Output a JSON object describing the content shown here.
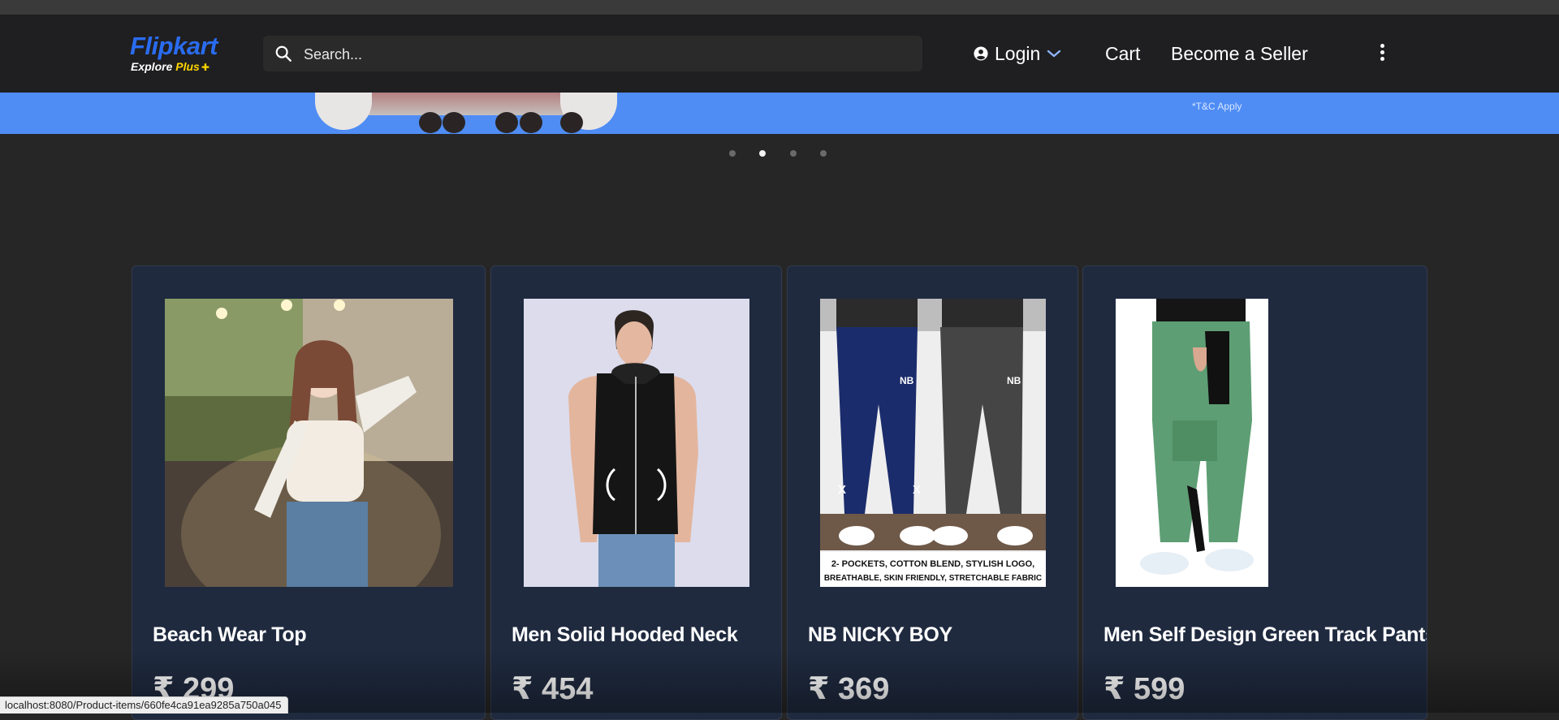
{
  "header": {
    "logo": {
      "name": "Flipkart",
      "sub_prefix": "Explore",
      "sub_plus": "Plus"
    },
    "search": {
      "placeholder": "Search..."
    },
    "login_label": "Login",
    "cart_label": "Cart",
    "seller_label": "Become a Seller"
  },
  "banner": {
    "note": "*T&C Apply"
  },
  "carousel": {
    "dot_count": 4,
    "active_index": 1
  },
  "currency_symbol": "₹",
  "products": [
    {
      "title": "Beach Wear Top",
      "price": "299"
    },
    {
      "title": "Men Solid Hooded Neck",
      "price": "454"
    },
    {
      "title": "NB NICKY BOY",
      "price": "369",
      "image_caption_1": "2- POCKETS, COTTON BLEND, STYLISH LOGO,",
      "image_caption_2": "BREATHABLE, SKIN FRIENDLY, STRETCHABLE FABRIC"
    },
    {
      "title": "Men Self Design Green Track Pants",
      "price": "599"
    }
  ],
  "status_bar": {
    "url": "localhost:8080/Product-items/660fe4ca91ea9285a750a045"
  },
  "colors": {
    "page_bg": "#262626",
    "navbar_bg": "#1f1f21",
    "brand_blue": "#2a6cf0",
    "plus_yellow": "#ffd400",
    "banner_blue": "#4f8df5",
    "card_bg": "#1f2a3f"
  }
}
